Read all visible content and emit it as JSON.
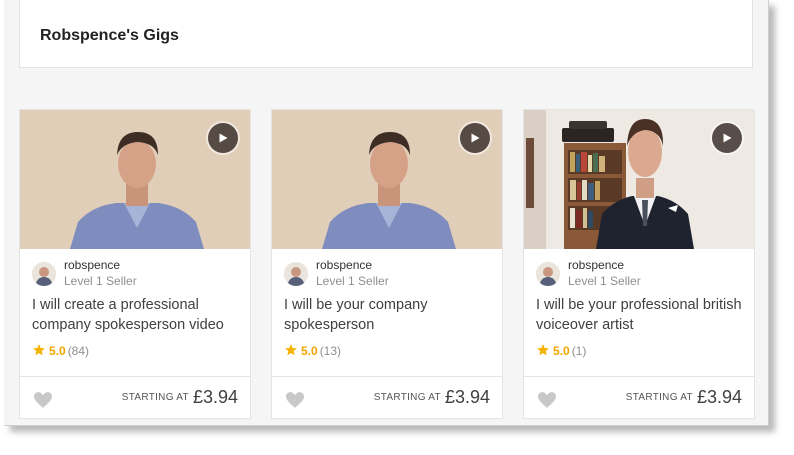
{
  "header": {
    "title": "Robspence's Gigs"
  },
  "gigs": [
    {
      "seller": "robspence",
      "level": "Level 1 Seller",
      "title": "I will create a professional company spokesperson video",
      "rating": "5.0",
      "reviews": "(84)",
      "starting_label": "STARTING AT",
      "price": "£3.94"
    },
    {
      "seller": "robspence",
      "level": "Level 1 Seller",
      "title": "I will be your company spokesperson",
      "rating": "5.0",
      "reviews": "(13)",
      "starting_label": "STARTING AT",
      "price": "£3.94"
    },
    {
      "seller": "robspence",
      "level": "Level 1 Seller",
      "title": "I will be your professional british voiceover artist",
      "rating": "5.0",
      "reviews": "(1)",
      "starting_label": "STARTING AT",
      "price": "£3.94"
    }
  ],
  "icons": {
    "play": "play-icon",
    "star": "star-icon",
    "heart": "heart-icon"
  },
  "colors": {
    "star": "#f5b301",
    "rating_text": "#f0a500",
    "heart": "#c8c8c8"
  }
}
